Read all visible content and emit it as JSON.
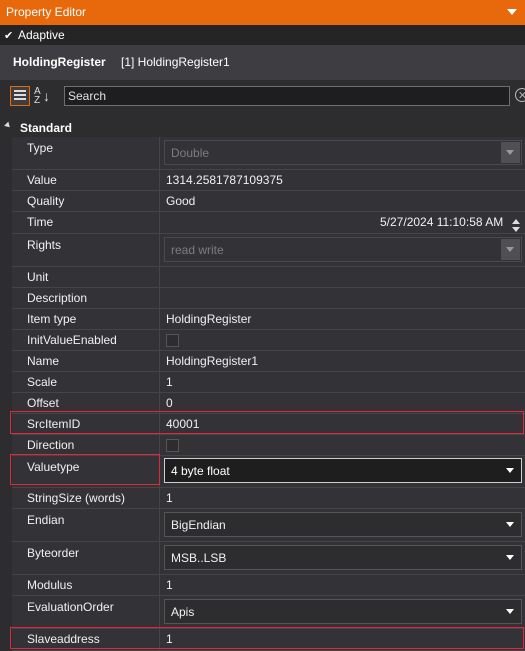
{
  "title": "Property Editor",
  "adaptive": {
    "checked": true,
    "check_glyph": "✔",
    "label": "Adaptive"
  },
  "header": {
    "object_name": "HoldingRegister",
    "object_id": "[1] HoldingRegister1"
  },
  "toolbar": {
    "search_value": "Search",
    "az_top": "A",
    "az_bottom": "Z",
    "az_arrow": "↓"
  },
  "category": {
    "name": "Standard",
    "expanded": true
  },
  "accent_color": "#e8680c",
  "highlight_color": "#e0283c",
  "properties": {
    "type": {
      "name": "Type",
      "value": "Double"
    },
    "value": {
      "name": "Value",
      "value": "1314.2581787109375"
    },
    "quality": {
      "name": "Quality",
      "value": "Good"
    },
    "time": {
      "name": "Time",
      "value": "5/27/2024 11:10:58 AM"
    },
    "rights": {
      "name": "Rights",
      "value": "read write"
    },
    "unit": {
      "name": "Unit",
      "value": ""
    },
    "description": {
      "name": "Description",
      "value": ""
    },
    "item_type": {
      "name": "Item type",
      "value": "HoldingRegister"
    },
    "init_value_enabled": {
      "name": "InitValueEnabled",
      "checked": false
    },
    "name": {
      "name": "Name",
      "value": "HoldingRegister1"
    },
    "scale": {
      "name": "Scale",
      "value": "1"
    },
    "offset": {
      "name": "Offset",
      "value": "0"
    },
    "src_item_id": {
      "name": "SrcItemID",
      "value": "40001"
    },
    "direction": {
      "name": "Direction",
      "checked": false
    },
    "valuetype": {
      "name": "Valuetype",
      "value": "4 byte float"
    },
    "string_size": {
      "name": "StringSize (words)",
      "value": "1"
    },
    "endian": {
      "name": "Endian",
      "value": "BigEndian"
    },
    "byteorder": {
      "name": "Byteorder",
      "value": "MSB..LSB"
    },
    "modulus": {
      "name": "Modulus",
      "value": "1"
    },
    "evaluation_order": {
      "name": "EvaluationOrder",
      "value": "Apis"
    },
    "slaveaddress": {
      "name": "Slaveaddress",
      "value": "1"
    }
  },
  "icons": [
    "chevron-down-icon",
    "checkbox-icon",
    "categorized-view-icon",
    "sort-alphabetical-icon",
    "clear-search-icon",
    "collapse-triangle-icon",
    "dropdown-arrow-icon",
    "spin-up-icon",
    "spin-down-icon"
  ]
}
